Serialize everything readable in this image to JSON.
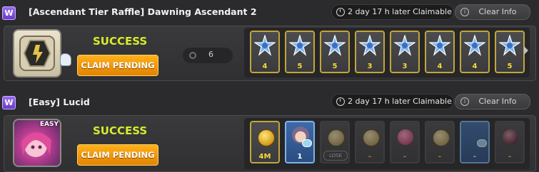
{
  "entries": [
    {
      "badge": "W",
      "title": "[Ascendant Tier Raffle] Dawning Ascendant 2",
      "claimable": "2 day 17 h later Claimable",
      "clear_label": "Clear Info",
      "status": "SUCCESS",
      "claim_label": "CLAIM PENDING",
      "count": "6",
      "rewards": [
        {
          "icon": "star-badge-icon",
          "qty": "4"
        },
        {
          "icon": "star-badge-icon",
          "qty": "5"
        },
        {
          "icon": "star-badge-icon",
          "qty": "5"
        },
        {
          "icon": "star-badge-icon",
          "qty": "3"
        },
        {
          "icon": "star-badge-icon",
          "qty": "3"
        },
        {
          "icon": "star-badge-icon",
          "qty": "4"
        },
        {
          "icon": "star-badge-icon",
          "qty": "4"
        },
        {
          "icon": "star-badge-icon",
          "qty": "5"
        }
      ]
    },
    {
      "badge": "W",
      "title": "[Easy] Lucid",
      "claimable": "2 day 17 h later Claimable",
      "clear_label": "Clear Info",
      "status": "SUCCESS",
      "claim_label": "CLAIM PENDING",
      "boss_tag": "EASY",
      "rewards": [
        {
          "icon": "meso-coin-icon",
          "qty": "4M"
        },
        {
          "icon": "character-icon",
          "qty": "1"
        },
        {
          "icon": "coin-icon",
          "qty": "",
          "tag": "LOSE"
        },
        {
          "icon": "coin-icon",
          "qty": "-"
        },
        {
          "icon": "pink-orb-icon",
          "qty": "-"
        },
        {
          "icon": "coin-icon",
          "qty": "-"
        },
        {
          "icon": "card-icon",
          "qty": "-"
        },
        {
          "icon": "dark-orb-icon",
          "qty": "-"
        }
      ]
    }
  ],
  "colors": {
    "success": "#d6ec2b",
    "claim": "#f29a0e",
    "gold_border": "#c2a53c",
    "blue_item": "#3d6aa8"
  }
}
